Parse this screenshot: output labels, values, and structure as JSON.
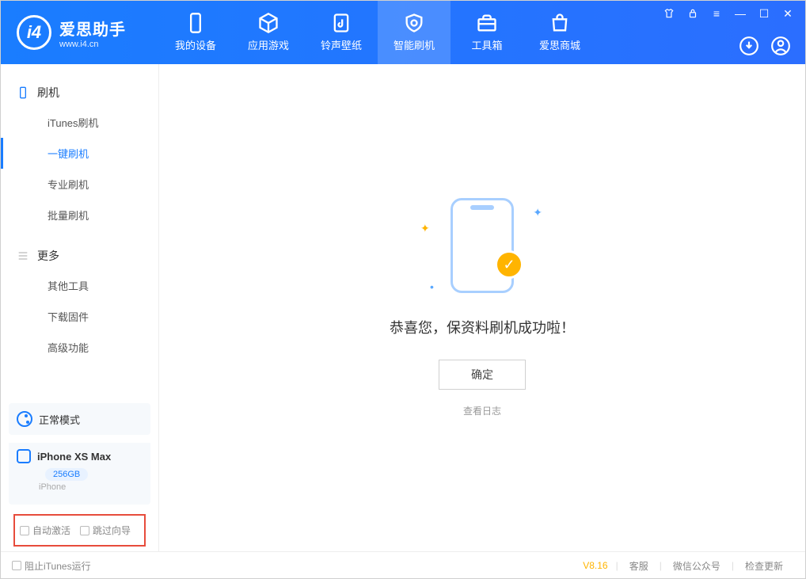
{
  "logo": {
    "title": "爱思助手",
    "sub": "www.i4.cn"
  },
  "nav": [
    {
      "id": "device",
      "label": "我的设备"
    },
    {
      "id": "apps",
      "label": "应用游戏"
    },
    {
      "id": "ring",
      "label": "铃声壁纸"
    },
    {
      "id": "flash",
      "label": "智能刷机"
    },
    {
      "id": "tools",
      "label": "工具箱"
    },
    {
      "id": "store",
      "label": "爱思商城"
    }
  ],
  "sidebar": {
    "group1": {
      "title": "刷机",
      "items": [
        {
          "id": "itunes",
          "label": "iTunes刷机"
        },
        {
          "id": "oneclick",
          "label": "一键刷机"
        },
        {
          "id": "pro",
          "label": "专业刷机"
        },
        {
          "id": "batch",
          "label": "批量刷机"
        }
      ]
    },
    "group2": {
      "title": "更多",
      "items": [
        {
          "id": "other",
          "label": "其他工具"
        },
        {
          "id": "firmware",
          "label": "下载固件"
        },
        {
          "id": "advanced",
          "label": "高级功能"
        }
      ]
    }
  },
  "device": {
    "mode": "正常模式",
    "name": "iPhone XS Max",
    "capacity": "256GB",
    "type": "iPhone"
  },
  "options": {
    "auto_activate": "自动激活",
    "skip_guide": "跳过向导"
  },
  "main": {
    "success": "恭喜您，保资料刷机成功啦！",
    "ok": "确定",
    "view_log": "查看日志"
  },
  "footer": {
    "block_itunes": "阻止iTunes运行",
    "version": "V8.16",
    "cs": "客服",
    "wechat": "微信公众号",
    "update": "检查更新"
  }
}
